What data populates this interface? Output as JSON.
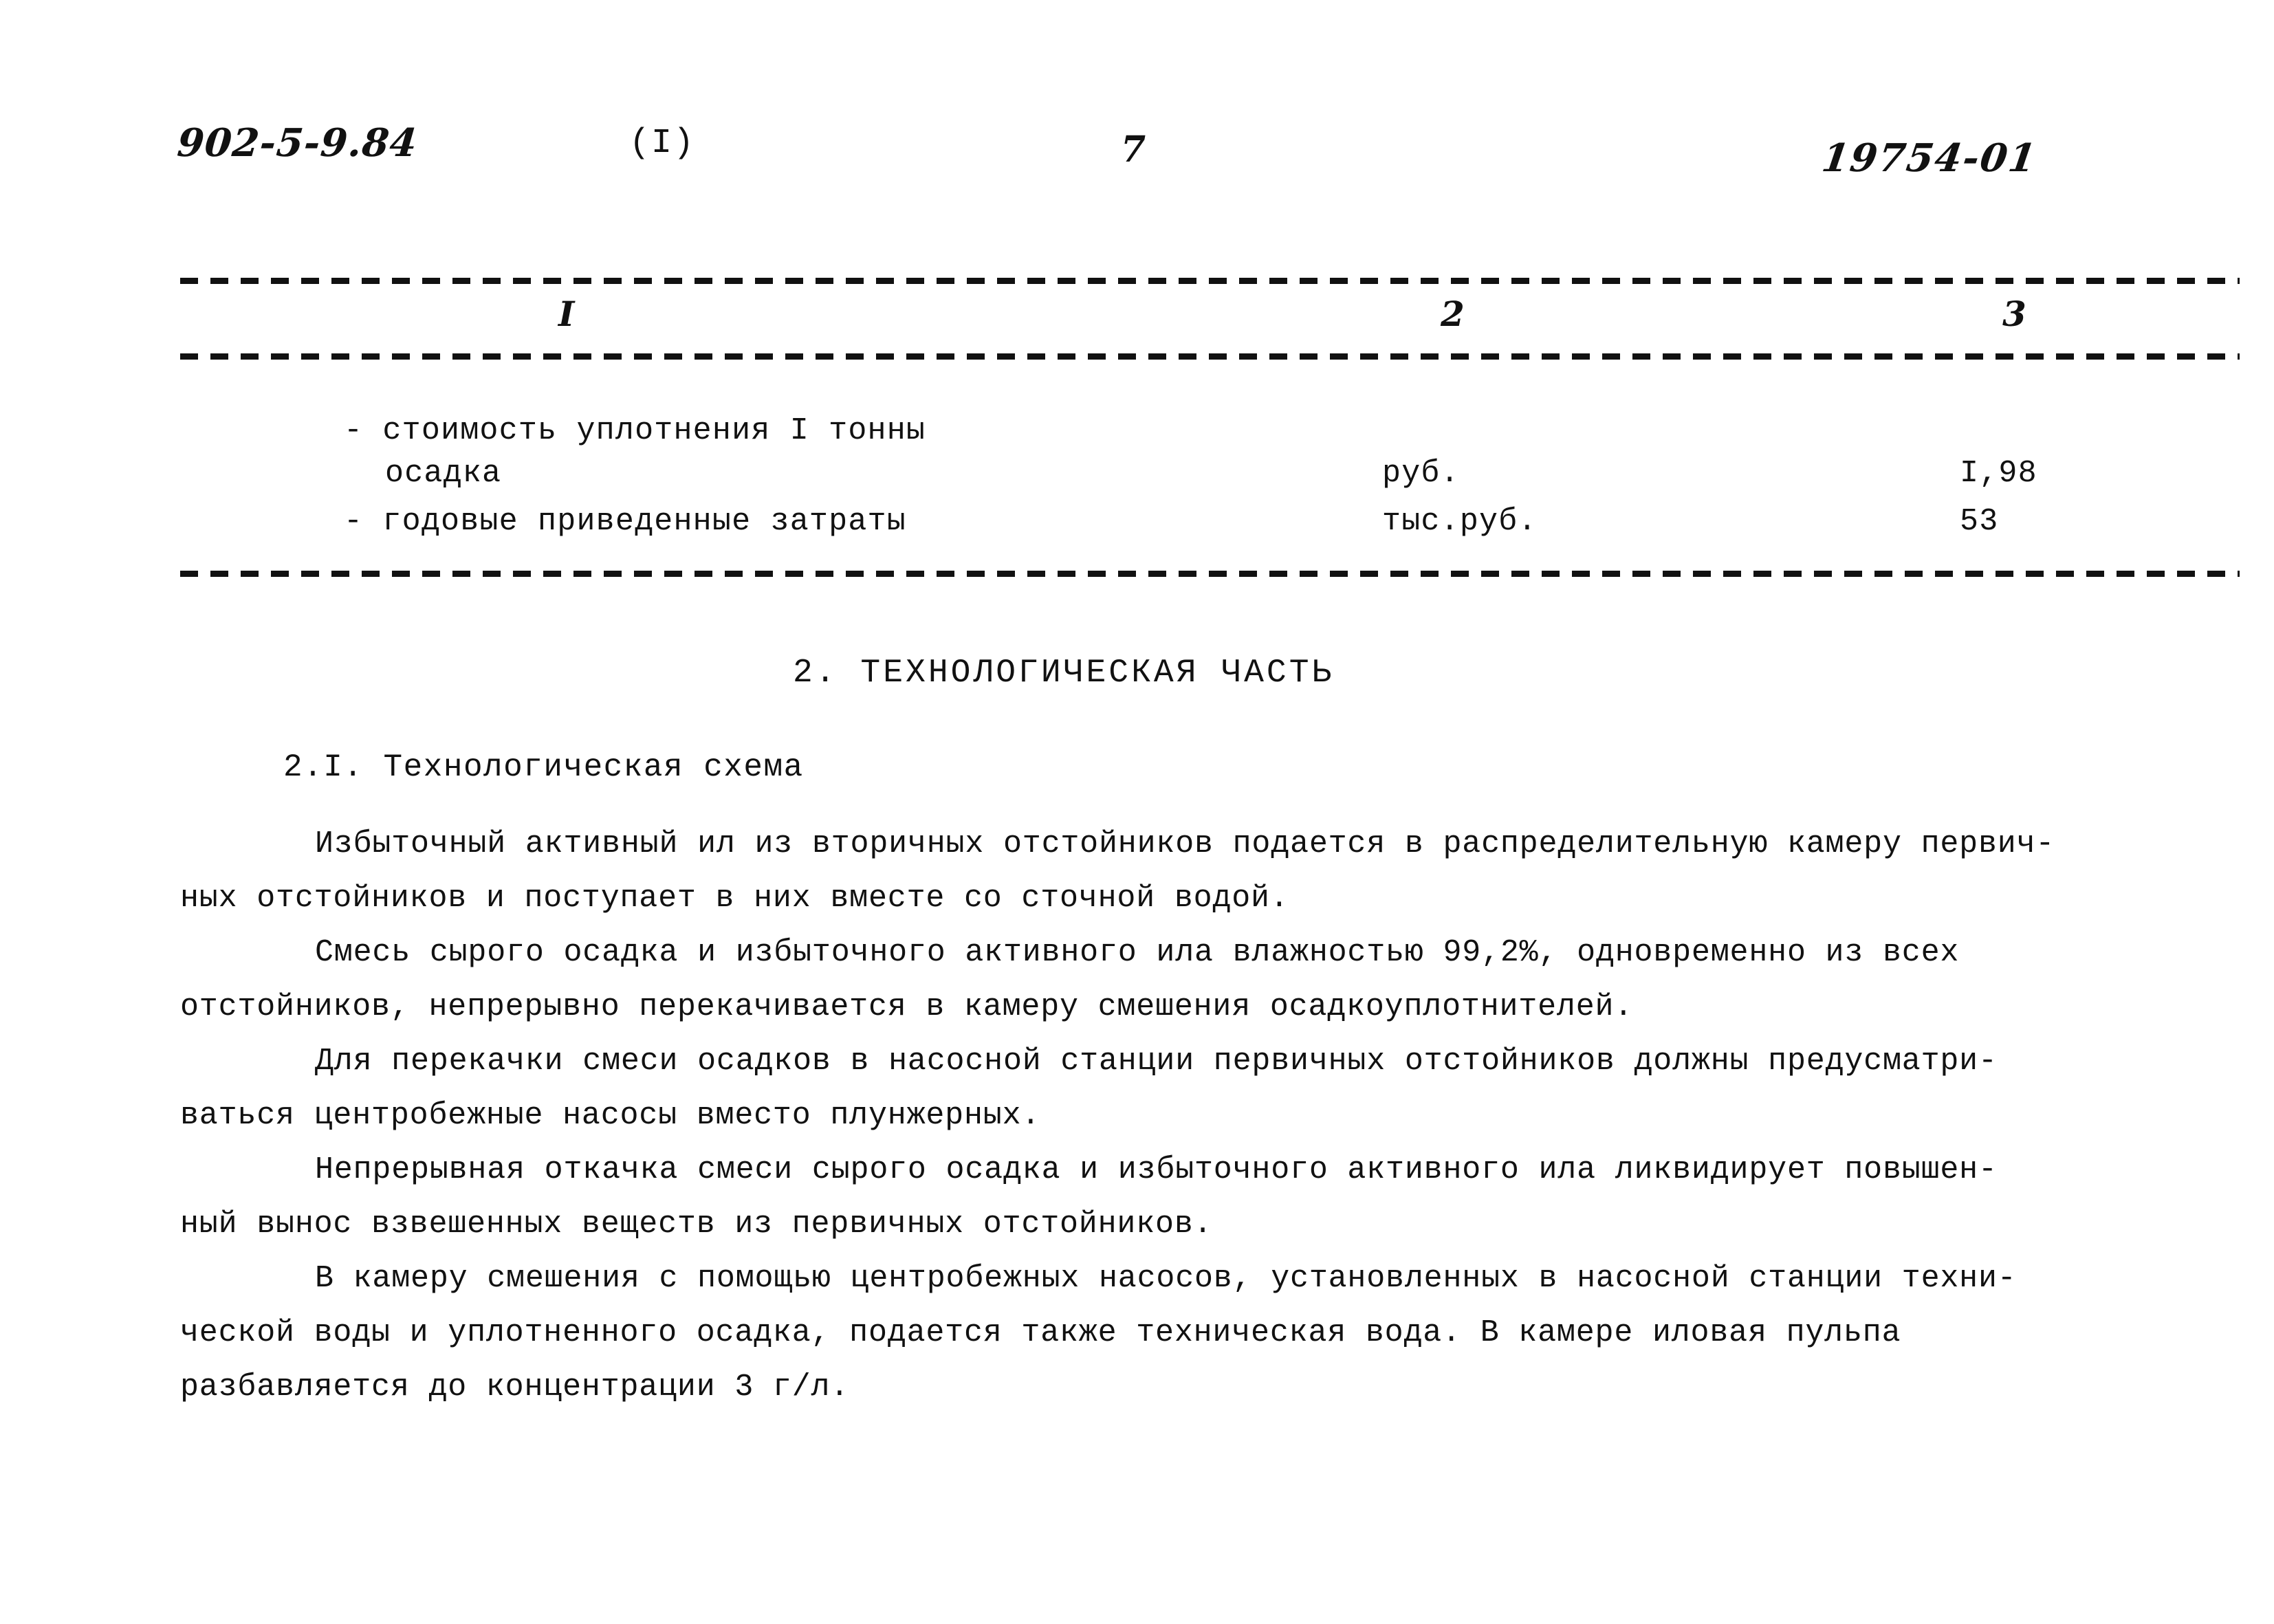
{
  "header": {
    "document_code": "902-5-9.84",
    "part_marker": "(I)",
    "page_number": "7",
    "archive_code": "19754-01"
  },
  "table": {
    "column_numbers": [
      "I",
      "2",
      "3"
    ],
    "rows": [
      {
        "name_line_1": "- стоимость уплотнения I тонны",
        "name_line_2": "осадка",
        "unit": "руб.",
        "value": "I,98"
      },
      {
        "name_line_1": "- годовые приведенные затраты",
        "name_line_2": "",
        "unit": "тыс.руб.",
        "value": "53"
      }
    ]
  },
  "section": {
    "heading": "2. ТЕХНОЛОГИЧЕСКАЯ ЧАСТЬ",
    "subsection_heading": "2.I. Технологическая схема"
  },
  "body": {
    "paragraphs": [
      {
        "lines": [
          "Избыточный активный ил из вторичных отстойников подается в распределительную камеру первич-",
          "ных отстойников и поступает в них вместе со сточной водой."
        ]
      },
      {
        "lines": [
          "Смесь сырого осадка и избыточного активного ила влажностью 99,2%, одновременно из всех",
          "отстойников, непрерывно перекачивается в камеру смешения осадкоуплотнителей."
        ]
      },
      {
        "lines": [
          "Для перекачки смеси осадков в насосной станции первичных отстойников должны предусматри-",
          "ваться центробежные насосы вместо плунжерных."
        ]
      },
      {
        "lines": [
          "Непрерывная откачка смеси сырого осадка и избыточного активного ила ликвидирует повышен-",
          "ный вынос взвешенных веществ из первичных отстойников."
        ]
      },
      {
        "lines": [
          "В камеру смешения с помощью центробежных насосов, установленных в насосной станции техни-",
          "ческой воды и уплотненного осадка, подается также техническая вода. В камере иловая пульпа",
          "разбавляется до концентрации 3 г/л."
        ]
      }
    ]
  }
}
